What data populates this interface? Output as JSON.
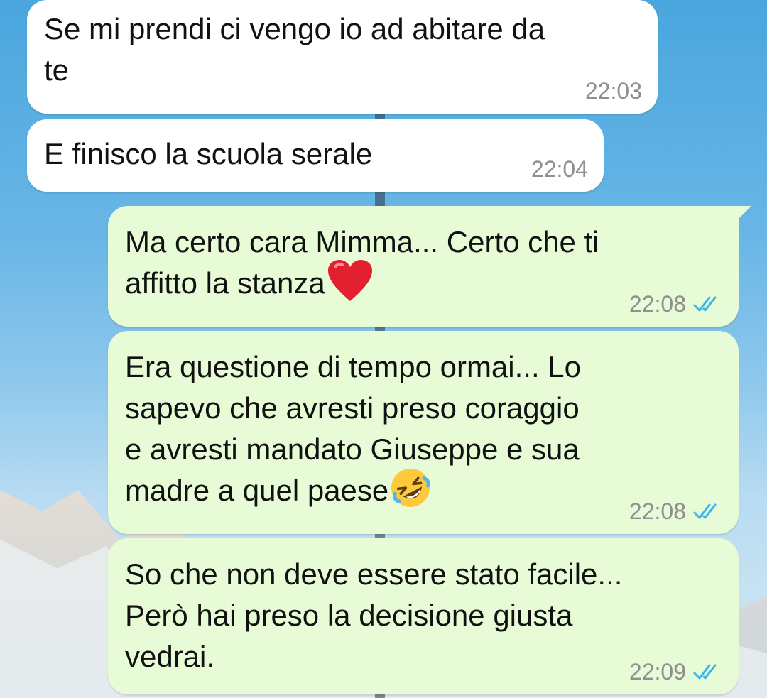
{
  "conversation": {
    "messages": [
      {
        "direction": "in",
        "text": "Se mi prendi ci vengo io ad abitare da\nte",
        "time": "22:03"
      },
      {
        "direction": "in",
        "text": "E finisco la scuola serale",
        "time": "22:04"
      },
      {
        "direction": "out",
        "text": "Ma certo cara Mimma... Certo che ti\naffitto la stanza",
        "emoji": "red-heart",
        "time": "22:08",
        "status": "read"
      },
      {
        "direction": "out",
        "text": "Era questione di tempo ormai... Lo\nsapevo che avresti preso coraggio\ne avresti mandato Giuseppe e sua\nmadre a quel paese",
        "emoji": "rolling-on-floor-laughing",
        "time": "22:08",
        "status": "read"
      },
      {
        "direction": "out",
        "text": "So che non deve essere stato facile...\nPerò hai preso la decisione giusta\nvedrai.",
        "time": "22:09",
        "status": "read"
      }
    ]
  },
  "theme": {
    "incoming_bubble": "#ffffff",
    "outgoing_bubble": "#e7fcd6",
    "read_tick": "#34b7f1",
    "timestamp": "#8f8f8f"
  }
}
